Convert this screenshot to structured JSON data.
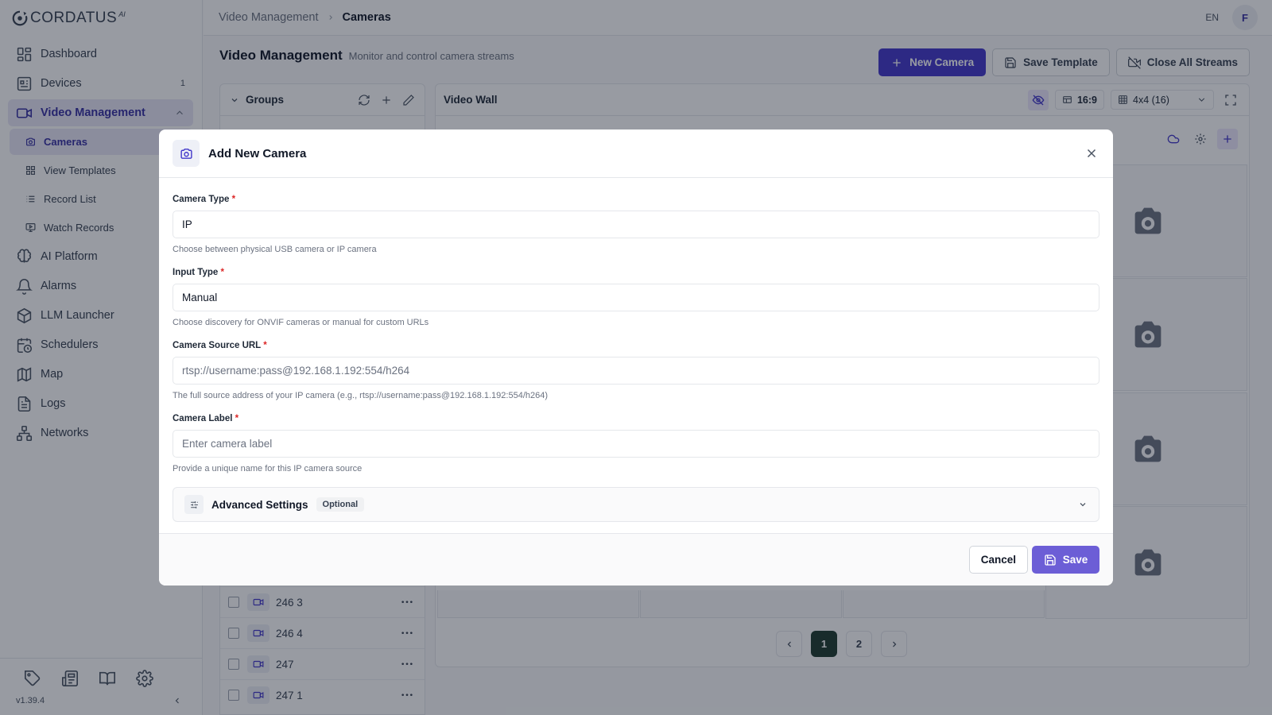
{
  "app": {
    "logo_text": "CORDATUS",
    "logo_sup": "AI",
    "version": "v1.39.4"
  },
  "sidebar": {
    "items": [
      {
        "label": "Dashboard",
        "icon": "dashboard-icon"
      },
      {
        "label": "Devices",
        "icon": "devices-icon",
        "badge": "1"
      },
      {
        "label": "Video Management",
        "icon": "video-icon",
        "active": true,
        "expanded": true
      },
      {
        "label": "AI Platform",
        "icon": "brain-icon"
      },
      {
        "label": "Alarms",
        "icon": "bell-icon"
      },
      {
        "label": "LLM Launcher",
        "icon": "box-icon"
      },
      {
        "label": "Schedulers",
        "icon": "calendar-clock-icon"
      },
      {
        "label": "Map",
        "icon": "map-icon"
      },
      {
        "label": "Logs",
        "icon": "file-text-icon"
      },
      {
        "label": "Networks",
        "icon": "network-icon"
      }
    ],
    "subitems": [
      {
        "label": "Cameras",
        "icon": "camera-icon",
        "active": true
      },
      {
        "label": "View Templates",
        "icon": "grid-icon"
      },
      {
        "label": "Record List",
        "icon": "list-icon"
      },
      {
        "label": "Watch Records",
        "icon": "monitor-play-icon"
      }
    ],
    "footer_icons": [
      "tag-icon",
      "newspaper-icon",
      "book-icon",
      "settings-icon"
    ]
  },
  "header": {
    "breadcrumb": [
      "Video Management",
      "Cameras"
    ],
    "language": "EN",
    "avatar_initial": "F"
  },
  "page": {
    "title": "Video Management",
    "subtitle": "Monitor and control camera streams",
    "buttons": {
      "new_camera": "New Camera",
      "save_template": "Save Template",
      "close_streams": "Close All Streams"
    }
  },
  "groups": {
    "title": "Groups",
    "cameras": [
      "246 3",
      "246 4",
      "247",
      "247 1"
    ]
  },
  "video_wall": {
    "title": "Video Wall",
    "aspect": "16:9",
    "layout": "4x4 (16)",
    "pages": [
      "1",
      "2"
    ],
    "current_page": "1"
  },
  "modal": {
    "title": "Add New Camera",
    "fields": {
      "camera_type": {
        "label": "Camera Type",
        "value": "IP",
        "hint": "Choose between physical USB camera or IP camera"
      },
      "input_type": {
        "label": "Input Type",
        "value": "Manual",
        "hint": "Choose discovery for ONVIF cameras or manual for custom URLs"
      },
      "source_url": {
        "label": "Camera Source URL",
        "placeholder": "rtsp://username:pass@192.168.1.192:554/h264",
        "hint": "The full source address of your IP camera (e.g., rtsp://username:pass@192.168.1.192:554/h264)"
      },
      "camera_label": {
        "label": "Camera Label",
        "placeholder": "Enter camera label",
        "hint": "Provide a unique name for this IP camera source"
      }
    },
    "required_mark": "*",
    "advanced": {
      "title": "Advanced Settings",
      "badge": "Optional"
    },
    "cancel_label": "Cancel",
    "save_label": "Save"
  }
}
